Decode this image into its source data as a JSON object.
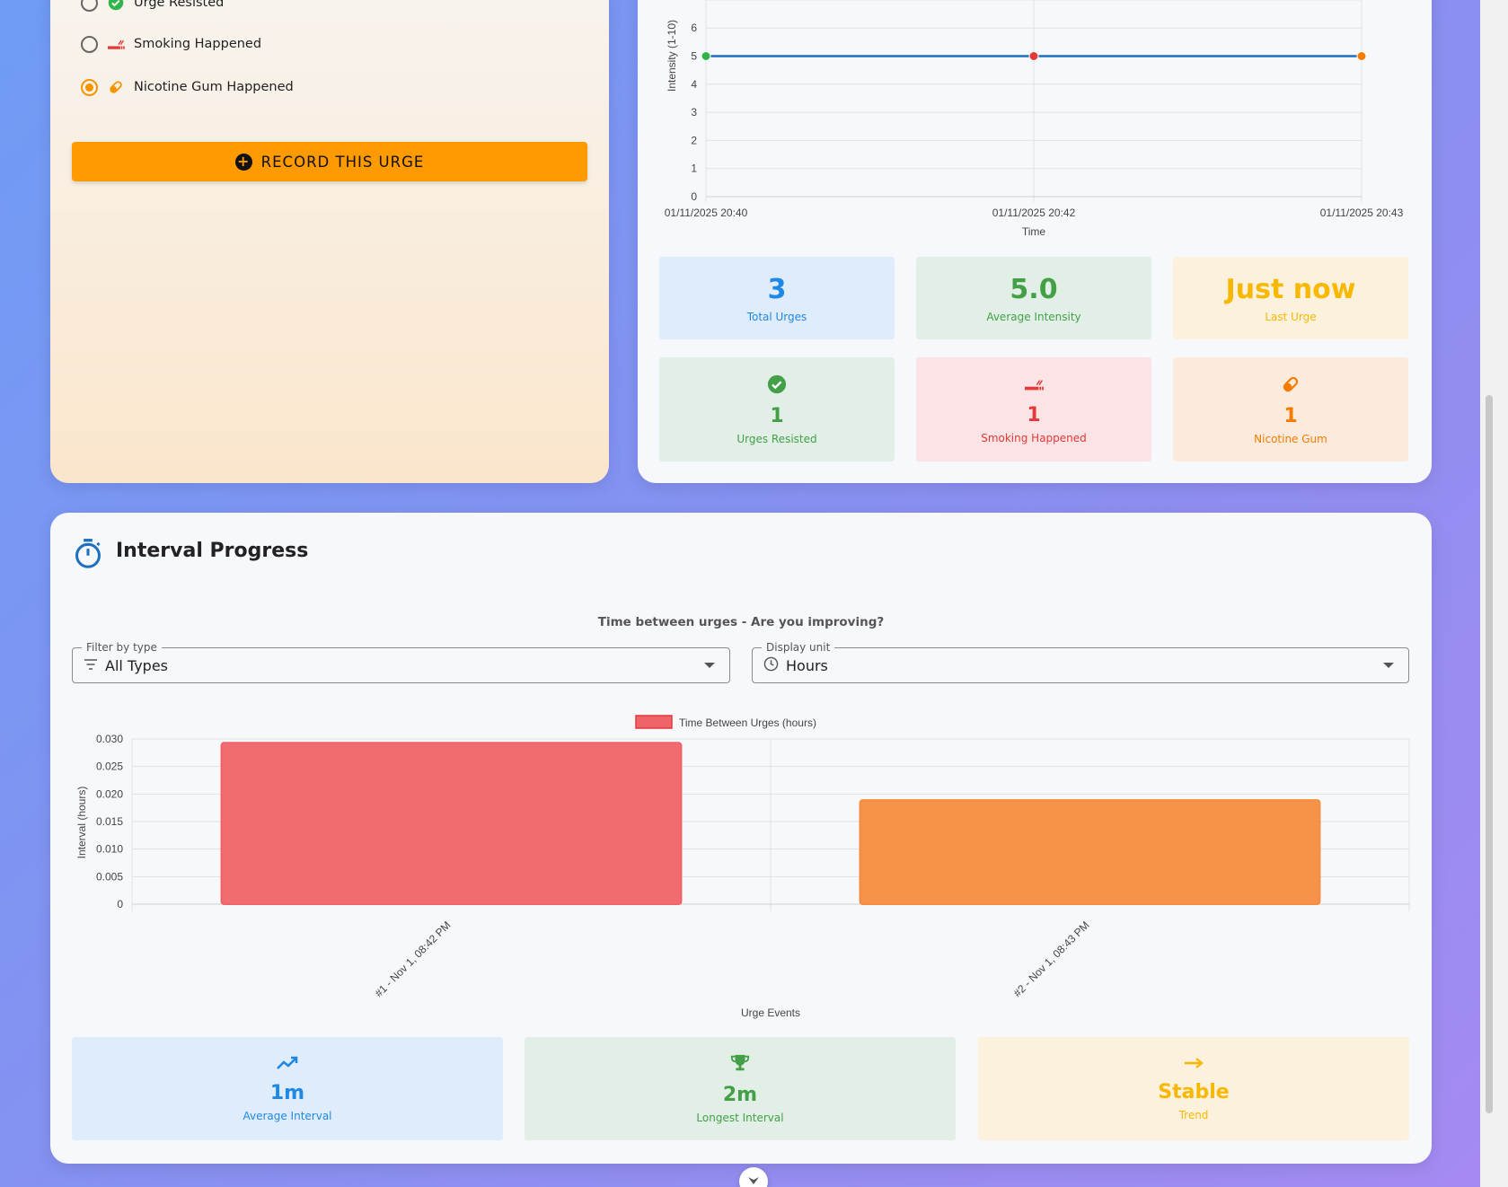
{
  "urge_form": {
    "options": [
      {
        "label": "Urge Resisted",
        "icon": "check-circle-icon",
        "selected": false
      },
      {
        "label": "Smoking Happened",
        "icon": "smoking-icon",
        "selected": false
      },
      {
        "label": "Nicotine Gum Happened",
        "icon": "pill-icon",
        "selected": true
      }
    ],
    "record_button": "RECORD THIS URGE"
  },
  "intensity_chart": {
    "chart_data": {
      "type": "line",
      "x": [
        "01/11/2025 20:40",
        "01/11/2025 20:42",
        "01/11/2025 20:43"
      ],
      "series": [
        {
          "values": [
            5,
            5,
            5
          ]
        }
      ],
      "point_colors": [
        "#2fb64a",
        "#e53935",
        "#f57c00"
      ],
      "xlabel": "Time",
      "ylabel": "Intensity (1-10)",
      "y_ticks_visible": [
        0,
        1,
        2,
        3,
        4,
        5,
        6
      ],
      "grid": true
    }
  },
  "summary_stats": [
    {
      "value": "3",
      "label": "Total Urges",
      "color": "#1e88e5"
    },
    {
      "value": "5.0",
      "label": "Average Intensity",
      "color": "#43a047"
    },
    {
      "value": "Just now",
      "label": "Last Urge",
      "color": "#f9b800"
    }
  ],
  "type_stats": [
    {
      "value": "1",
      "label": "Urges Resisted",
      "icon": "check-circle-icon",
      "color": "#43a047"
    },
    {
      "value": "1",
      "label": "Smoking Happened",
      "icon": "smoking-icon",
      "color": "#e53935"
    },
    {
      "value": "1",
      "label": "Nicotine Gum",
      "icon": "pill-icon",
      "color": "#f57c00"
    }
  ],
  "interval": {
    "title": "Interval Progress",
    "subtitle": "Time between urges - Are you improving?",
    "filter": {
      "legend": "Filter by type",
      "value": "All Types"
    },
    "unit": {
      "legend": "Display unit",
      "value": "Hours"
    },
    "chart_data": {
      "type": "bar",
      "categories": [
        "#1 - Nov 1, 08:42 PM",
        "#2 - Nov 1, 08:43 PM"
      ],
      "series": [
        {
          "name": "Time Between Urges (hours)",
          "values": [
            0.0293,
            0.0189
          ]
        }
      ],
      "bar_colors": [
        "#ef6468",
        "#f68c3f"
      ],
      "xlabel": "Urge Events",
      "ylabel": "Interval (hours)",
      "ylim": [
        0,
        0.03
      ],
      "y_ticks": [
        "0",
        "0.005",
        "0.010",
        "0.015",
        "0.020",
        "0.025",
        "0.030"
      ],
      "legend": "top-center",
      "grid": true
    },
    "stats": [
      {
        "value": "1m",
        "label": "Average Interval",
        "icon": "trending-up-icon",
        "color": "#1e88e5"
      },
      {
        "value": "2m",
        "label": "Longest Interval",
        "icon": "trophy-icon",
        "color": "#43a047"
      },
      {
        "value": "Stable",
        "label": "Trend",
        "icon": "arrow-right-icon",
        "color": "#f9b800"
      }
    ]
  }
}
